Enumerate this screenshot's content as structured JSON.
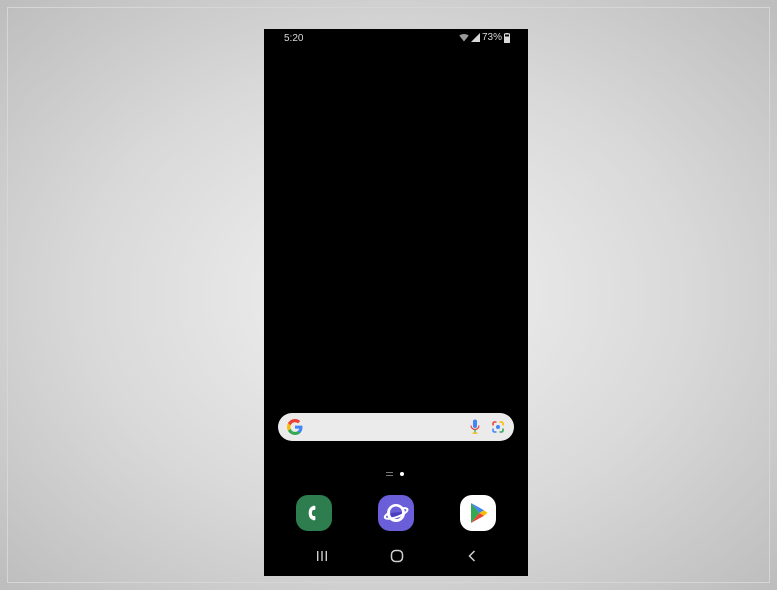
{
  "status_bar": {
    "time": "5:20",
    "battery": "73%",
    "icons": [
      "wifi-icon",
      "signal-icon",
      "battery-icon"
    ]
  },
  "search_bar": {
    "icons": [
      "google-g-icon",
      "microphone-icon",
      "google-lens-icon"
    ]
  },
  "home_pages": {
    "icons": [
      "home-page-indicator-icon",
      "page-dot-active-icon"
    ]
  },
  "dock": {
    "apps": [
      {
        "icon": "phone-app-icon",
        "color": "#2e7d4f"
      },
      {
        "icon": "samsung-internet-app-icon",
        "color": "#6b5fd9"
      },
      {
        "icon": "play-store-app-icon",
        "color": "#ffffff"
      }
    ]
  },
  "navigation": {
    "buttons": [
      "recents-icon",
      "home-icon",
      "back-icon"
    ]
  },
  "colors": {
    "background": "#000000",
    "search_bar": "#ebebeb",
    "google_blue": "#4285f4",
    "google_red": "#ea4335",
    "google_yellow": "#fbbc05",
    "google_green": "#34a853"
  }
}
